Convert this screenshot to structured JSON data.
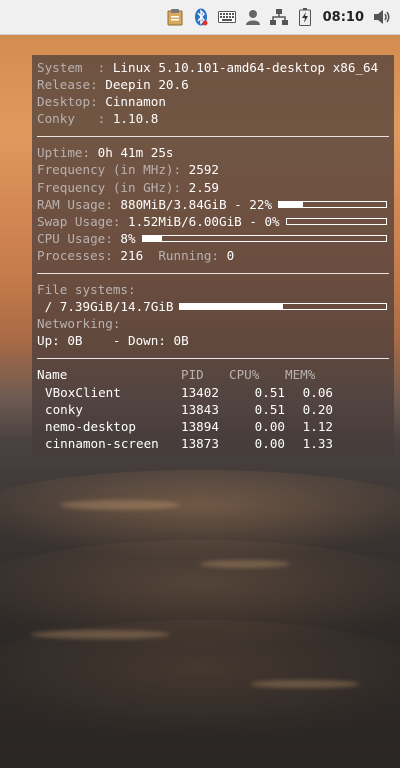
{
  "topbar": {
    "clock": "08:10",
    "icons": [
      "clipboard-icon",
      "bluetooth-icon",
      "keyboard-icon",
      "user-icon",
      "network-icon",
      "battery-icon",
      "volume-icon"
    ]
  },
  "conky": {
    "system": {
      "label": "System  : ",
      "value": "Linux 5.10.101-amd64-desktop x86_64"
    },
    "release": {
      "label": "Release: ",
      "value": "Deepin 20.6"
    },
    "desktop": {
      "label": "Desktop: ",
      "value": "Cinnamon"
    },
    "conky_ver": {
      "label": "Conky   : ",
      "value": "1.10.8"
    },
    "uptime": {
      "label": "Uptime: ",
      "value": "0h 41m 25s"
    },
    "freq_mhz": {
      "label": "Frequency (in MHz): ",
      "value": "2592"
    },
    "freq_ghz": {
      "label": "Frequency (in GHz): ",
      "value": "2.59"
    },
    "ram": {
      "label": "RAM Usage: ",
      "value": "880MiB/3.84GiB - 22%",
      "percent": 22
    },
    "swap": {
      "label": "Swap Usage: ",
      "value": "1.52MiB/6.00GiB - 0%",
      "percent": 0
    },
    "cpu": {
      "label": "CPU Usage: ",
      "value": "8%",
      "percent": 8
    },
    "processes": {
      "label": "Processes: ",
      "value": "216",
      "running_label": "  Running: ",
      "running_value": "0"
    },
    "fs_title": "File systems:",
    "fs_root": {
      "value": " / 7.39GiB/14.7GiB",
      "percent": 50
    },
    "net_title": "Networking:",
    "net": {
      "up_label": "Up: ",
      "up": "0B",
      "down_label": "    - Down: ",
      "down": "0B"
    },
    "proc_headers": {
      "name": "Name",
      "pid": "PID",
      "cpu": "CPU%",
      "mem": "MEM%"
    },
    "procs": [
      {
        "name": "VBoxClient",
        "pid": "13402",
        "cpu": "0.51",
        "mem": "0.06"
      },
      {
        "name": "conky",
        "pid": "13843",
        "cpu": "0.51",
        "mem": "0.20"
      },
      {
        "name": "nemo-desktop",
        "pid": "13894",
        "cpu": "0.00",
        "mem": "1.12"
      },
      {
        "name": "cinnamon-screen",
        "pid": "13873",
        "cpu": "0.00",
        "mem": "1.33"
      }
    ]
  }
}
